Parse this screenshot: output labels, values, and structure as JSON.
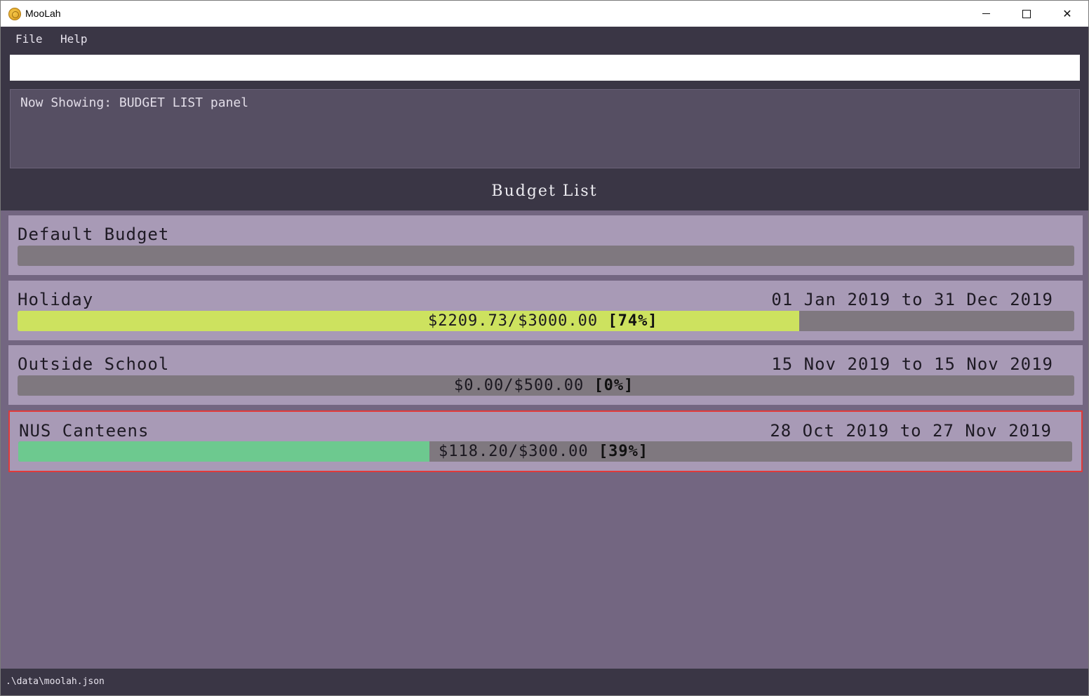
{
  "window": {
    "title": "MooLah",
    "icon": "coin-icon"
  },
  "menu": {
    "file": "File",
    "help": "Help"
  },
  "command": {
    "value": ""
  },
  "result": {
    "text": "Now Showing: BUDGET LIST panel"
  },
  "list": {
    "title": "Budget List"
  },
  "budgets": [
    {
      "name": "Default Budget",
      "dates": "",
      "amount": "",
      "percent_label": "",
      "progress": 0
    },
    {
      "name": "Holiday",
      "dates": "01 Jan 2019 to 31 Dec 2019",
      "amount": "$2209.73/$3000.00",
      "percent_label": "[74%]",
      "progress": 0.74,
      "fill_color": "#cde25f"
    },
    {
      "name": "Outside School",
      "dates": "15 Nov 2019 to 15 Nov 2019",
      "amount": "$0.00/$500.00",
      "percent_label": "[0%]",
      "progress": 0.0
    },
    {
      "name": "NUS Canteens",
      "dates": "28 Oct 2019 to 27 Nov 2019",
      "amount": "$118.20/$300.00",
      "percent_label": "[39%]",
      "progress": 0.39,
      "fill_color": "#6dc98f",
      "selected": true
    }
  ],
  "status": {
    "path": ".\\data\\moolah.json"
  },
  "colors": {
    "background": "#736681",
    "dark": "#3a3645",
    "card": "#a89ab6",
    "bar_track": "#7f787f",
    "selected_border": "#e03a3a"
  }
}
